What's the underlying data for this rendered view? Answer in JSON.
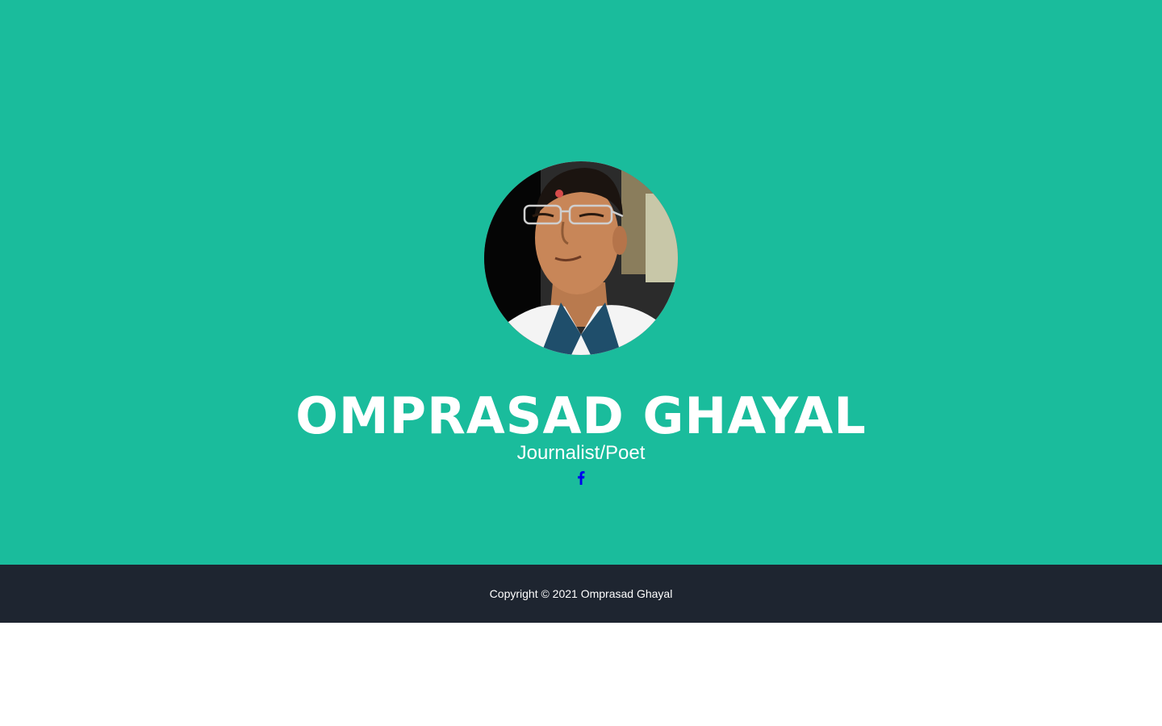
{
  "profile": {
    "name": "OMPRASAD GHAYAL",
    "subtitle": "Journalist/Poet",
    "social_icon": "facebook-icon",
    "photo_alt": "profile photo"
  },
  "footer": {
    "copyright": "Copyright © 2021 Omprasad Ghayal"
  },
  "colors": {
    "hero_bg": "#1abc9c",
    "footer_bg": "#1e2530",
    "text": "#ffffff",
    "social_link": "#0000ee"
  }
}
